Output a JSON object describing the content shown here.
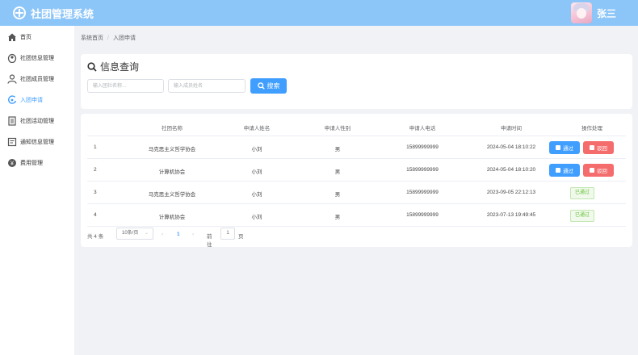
{
  "app": {
    "title": "社团管理系统",
    "user_name": "张三"
  },
  "sidebar": {
    "items": [
      {
        "label": "首页",
        "icon": "home-icon"
      },
      {
        "label": "社团信息管理",
        "icon": "info-icon"
      },
      {
        "label": "社团成员管理",
        "icon": "user-icon"
      },
      {
        "label": "入团申请",
        "icon": "apply-icon"
      },
      {
        "label": "社团活动管理",
        "icon": "activity-icon"
      },
      {
        "label": "通知信息管理",
        "icon": "notice-icon"
      },
      {
        "label": "费用管理",
        "icon": "fee-icon"
      }
    ],
    "active_index": 3
  },
  "breadcrumb": {
    "home": "系统首页",
    "separator": "/",
    "current": "入团申请"
  },
  "search": {
    "title": "信息查询",
    "club_placeholder": "输入团社名称...",
    "member_placeholder": "输入成员姓名",
    "button_label": "搜索"
  },
  "table": {
    "headers": [
      "社团名称",
      "申请人姓名",
      "申请人性别",
      "申请人电话",
      "申请时间",
      "操作处理"
    ],
    "rows": [
      {
        "index": "1",
        "club": "马克思主义哲学协会",
        "name": "小刘",
        "gender": "男",
        "phone": "15899999999",
        "time": "2024-05-04 18:10:22",
        "status": "pending"
      },
      {
        "index": "2",
        "club": "计算机协会",
        "name": "小刘",
        "gender": "男",
        "phone": "15899999999",
        "time": "2024-05-04 18:10:20",
        "status": "pending"
      },
      {
        "index": "3",
        "club": "马克思主义哲学协会",
        "name": "小刘",
        "gender": "男",
        "phone": "15899999999",
        "time": "2023-09-05 22:12:13",
        "status": "passed"
      },
      {
        "index": "4",
        "club": "计算机协会",
        "name": "小刘",
        "gender": "男",
        "phone": "15899999999",
        "time": "2023-07-13 19:49:45",
        "status": "passed"
      }
    ],
    "pass_label": "通过",
    "reject_label": "驳回",
    "passed_label": "已通过"
  },
  "pagination": {
    "total_text": "共 4 条",
    "page_size": "10条/页",
    "current_page": "1",
    "goto_label": "前往",
    "goto_value": "1",
    "goto_unit": "页"
  },
  "colors": {
    "header": "#8cc5f8",
    "primary": "#409eff",
    "danger": "#f56c6c",
    "success": "#67c23a"
  }
}
